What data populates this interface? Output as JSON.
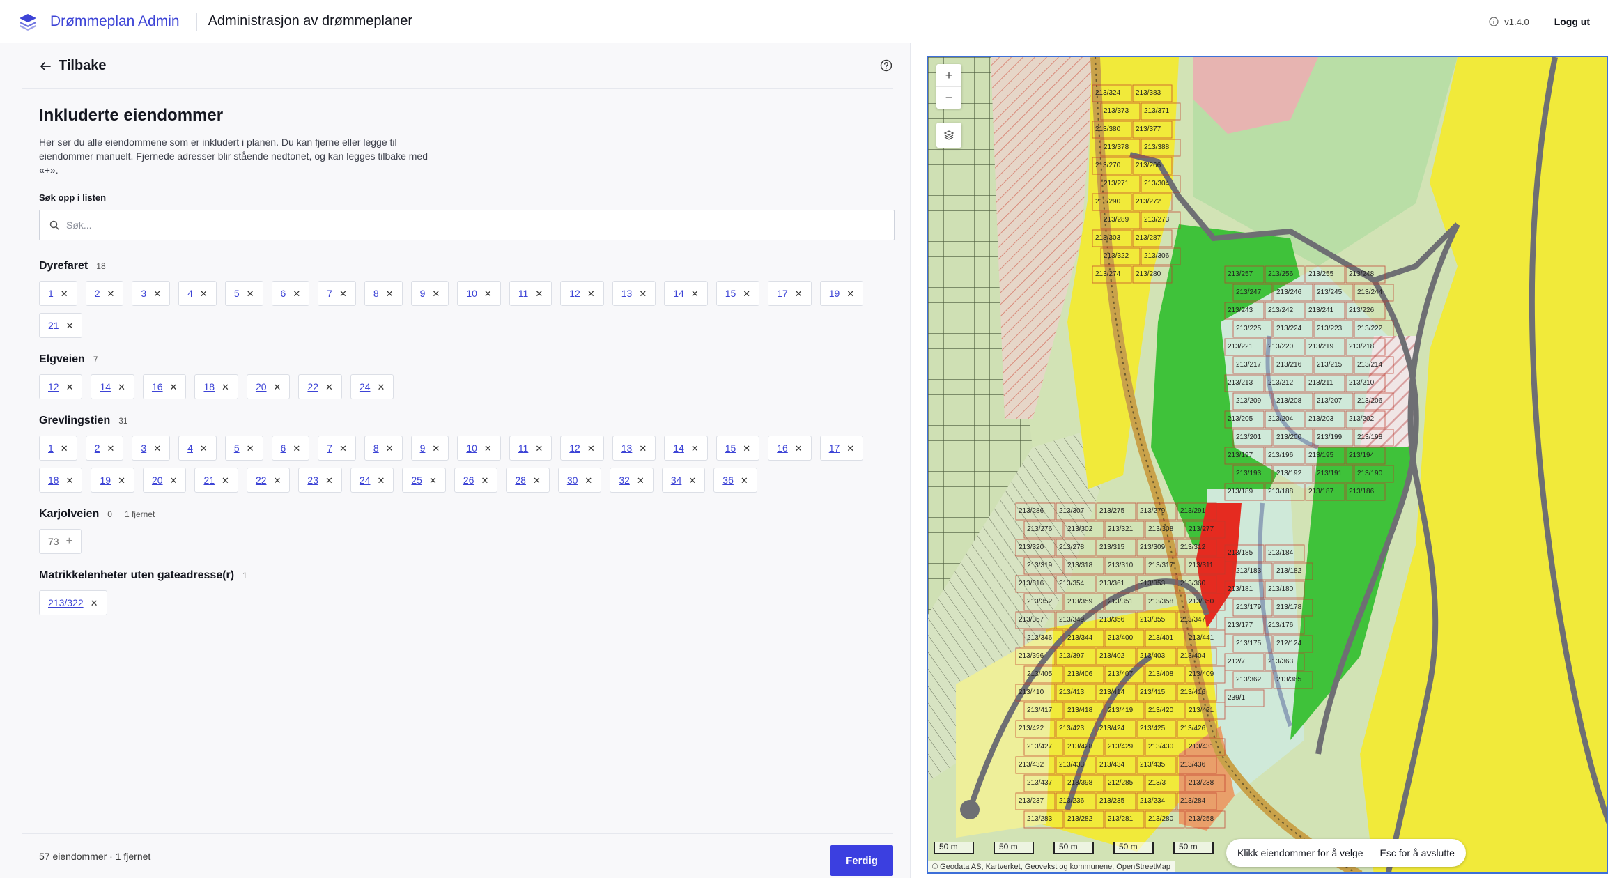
{
  "header": {
    "brand": "Drømmeplan Admin",
    "title": "Administrasjon av drømmeplaner",
    "version": "v1.4.0",
    "logout": "Logg ut",
    "brand_color": "#3d44d6"
  },
  "panel": {
    "back_label": "Tilbake",
    "heading": "Inkluderte eiendommer",
    "description": "Her ser du alle eiendommene som er inkludert i planen. Du kan fjerne eller legge til eiendommer manuelt. Fjernede adresser blir stående nedtonet, og kan legges tilbake med «+».",
    "search_label": "Søk opp i listen",
    "search_placeholder": "Søk...",
    "search_value": ""
  },
  "groups": [
    {
      "name": "Dyrefaret",
      "count": "18",
      "removed": "",
      "items": [
        "1",
        "2",
        "3",
        "4",
        "5",
        "6",
        "7",
        "8",
        "9",
        "10",
        "11",
        "12",
        "13",
        "14",
        "15",
        "17",
        "19",
        "21"
      ],
      "removed_items": []
    },
    {
      "name": "Elgveien",
      "count": "7",
      "removed": "",
      "items": [
        "12",
        "14",
        "16",
        "18",
        "20",
        "22",
        "24"
      ],
      "removed_items": []
    },
    {
      "name": "Grevlingstien",
      "count": "31",
      "removed": "",
      "items": [
        "1",
        "2",
        "3",
        "4",
        "5",
        "6",
        "7",
        "8",
        "9",
        "10",
        "11",
        "12",
        "13",
        "14",
        "15",
        "16",
        "17",
        "18",
        "19",
        "20",
        "21",
        "22",
        "23",
        "24",
        "25",
        "26",
        "28",
        "30",
        "32",
        "34",
        "36"
      ],
      "removed_items": []
    },
    {
      "name": "Karjolveien",
      "count": "0",
      "removed": "1 fjernet",
      "items": [],
      "removed_items": [
        "73"
      ]
    },
    {
      "name": "Matrikkelenheter uten gateadresse(r)",
      "count": "1",
      "removed": "",
      "items": [
        "213/322"
      ],
      "removed_items": []
    }
  ],
  "footer": {
    "summary": "57 eiendommer · 1 fjernet",
    "done": "Ferdig",
    "done_color": "#3b3fe0"
  },
  "map": {
    "zoom_in": "+",
    "zoom_out": "−",
    "hint_select": "Klikk eiendommer for å velge",
    "hint_exit": "Esc for å avslutte",
    "scale_labels": [
      "50 m",
      "50 m",
      "50 m",
      "50 m",
      "50 m"
    ],
    "attribution": "© Geodata AS, Kartverket, Geovekst og kommunene, OpenStreetMap",
    "parcel_labels": [
      "213/324",
      "213/383",
      "213/373",
      "213/371",
      "213/380",
      "213/377",
      "213/378",
      "213/388",
      "213/270",
      "213/266",
      "213/271",
      "213/304",
      "213/290",
      "213/272",
      "213/289",
      "213/273",
      "213/303",
      "213/287",
      "213/322",
      "213/306",
      "213/274",
      "213/280",
      "213/286",
      "213/307",
      "213/275",
      "213/279",
      "213/291",
      "213/276",
      "213/302",
      "213/321",
      "213/308",
      "213/277",
      "213/320",
      "213/278",
      "213/315",
      "213/309",
      "213/312",
      "213/319",
      "213/318",
      "213/310",
      "213/317",
      "213/311",
      "213/316",
      "213/354",
      "213/361",
      "213/353",
      "213/360",
      "213/352",
      "213/359",
      "213/351",
      "213/358",
      "213/350",
      "213/357",
      "213/349",
      "213/356",
      "213/355",
      "213/347",
      "213/346",
      "213/344",
      "213/400",
      "213/401",
      "213/441",
      "213/396",
      "213/397",
      "213/402",
      "213/403",
      "213/404",
      "213/405",
      "213/406",
      "213/407",
      "213/408",
      "213/409",
      "213/410",
      "213/413",
      "213/414",
      "213/415",
      "213/416",
      "213/417",
      "213/418",
      "213/419",
      "213/420",
      "213/421",
      "213/422",
      "213/423",
      "213/424",
      "213/425",
      "213/426",
      "213/427",
      "213/428",
      "213/429",
      "213/430",
      "213/431",
      "213/432",
      "213/433",
      "213/434",
      "213/435",
      "213/436",
      "213/437",
      "213/398",
      "212/285",
      "213/3",
      "213/238",
      "213/237",
      "213/236",
      "213/235",
      "213/234",
      "213/284",
      "213/283",
      "213/282",
      "213/281",
      "213/280",
      "213/258",
      "213/257",
      "213/256",
      "213/255",
      "213/248",
      "213/247",
      "213/246",
      "213/245",
      "213/244",
      "213/243",
      "213/242",
      "213/241",
      "213/226",
      "213/225",
      "213/224",
      "213/223",
      "213/222",
      "213/221",
      "213/220",
      "213/219",
      "213/218",
      "213/217",
      "213/216",
      "213/215",
      "213/214",
      "213/213",
      "213/212",
      "213/211",
      "213/210",
      "213/209",
      "213/208",
      "213/207",
      "213/206",
      "213/205",
      "213/204",
      "213/203",
      "213/202",
      "213/201",
      "213/200",
      "213/199",
      "213/198",
      "213/197",
      "213/196",
      "213/195",
      "213/194",
      "213/193",
      "213/192",
      "213/191",
      "213/190",
      "213/189",
      "213/188",
      "213/187",
      "213/186",
      "213/185",
      "213/184",
      "213/183",
      "213/182",
      "213/181",
      "213/180",
      "213/179",
      "213/178",
      "213/177",
      "213/176",
      "213/175",
      "212/124",
      "212/7",
      "213/363",
      "213/362",
      "213/365",
      "239/1"
    ]
  }
}
